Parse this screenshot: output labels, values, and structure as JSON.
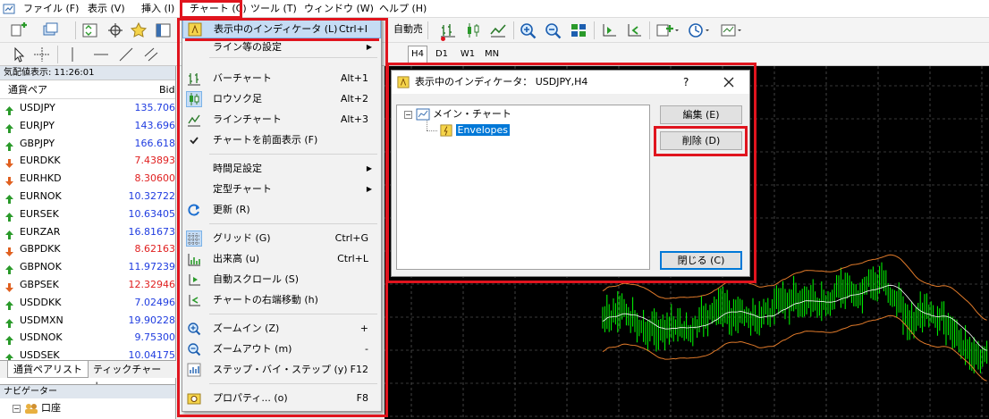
{
  "menubar": {
    "items": [
      "ファイル (F)",
      "表示 (V)",
      "挿入 (I)",
      "チャート (C)",
      "ツール (T)",
      "ウィンドウ (W)",
      "ヘルプ (H)"
    ]
  },
  "toolbar": {
    "auto_trade_label": "自動売買",
    "timeframes": [
      "H4",
      "D1",
      "W1",
      "MN"
    ],
    "active_timeframe": "H4"
  },
  "market_watch": {
    "title": "気配値表示: 11:26:01",
    "columns": {
      "symbol": "通貨ペア",
      "bid": "Bid"
    },
    "rows": [
      {
        "symbol": "USDJPY",
        "bid": "135.706",
        "dir": "up"
      },
      {
        "symbol": "EURJPY",
        "bid": "143.696",
        "dir": "up"
      },
      {
        "symbol": "GBPJPY",
        "bid": "166.618",
        "dir": "up"
      },
      {
        "symbol": "EURDKK",
        "bid": "7.43893",
        "dir": "down"
      },
      {
        "symbol": "EURHKD",
        "bid": "8.30600",
        "dir": "down"
      },
      {
        "symbol": "EURNOK",
        "bid": "10.32722",
        "dir": "up"
      },
      {
        "symbol": "EURSEK",
        "bid": "10.63405",
        "dir": "up"
      },
      {
        "symbol": "EURZAR",
        "bid": "16.81673",
        "dir": "up"
      },
      {
        "symbol": "GBPDKK",
        "bid": "8.62163",
        "dir": "down"
      },
      {
        "symbol": "GBPNOK",
        "bid": "11.97239",
        "dir": "up"
      },
      {
        "symbol": "GBPSEK",
        "bid": "12.32946",
        "dir": "down"
      },
      {
        "symbol": "USDDKK",
        "bid": "7.02496",
        "dir": "up"
      },
      {
        "symbol": "USDMXN",
        "bid": "19.90228",
        "dir": "up"
      },
      {
        "symbol": "USDNOK",
        "bid": "9.75300",
        "dir": "up"
      },
      {
        "symbol": "USDSEK",
        "bid": "10.04175",
        "dir": "up"
      }
    ],
    "tabs": [
      "通貨ペアリスト",
      "ティックチャート"
    ]
  },
  "navigator": {
    "title": "ナビゲーター",
    "root_label": "口座"
  },
  "chart_menu": {
    "items": [
      {
        "label": "表示中のインディケータ (L)",
        "shortcut": "Ctrl+I",
        "icon": "indicator-list-icon"
      },
      {
        "label": "ライン等の設定",
        "shortcut": "",
        "icon": "",
        "submenu": true
      },
      {
        "label": "バーチャート",
        "shortcut": "Alt+1",
        "icon": "bar-chart-icon"
      },
      {
        "label": "ロウソク足",
        "shortcut": "Alt+2",
        "icon": "candlestick-icon"
      },
      {
        "label": "ラインチャート",
        "shortcut": "Alt+3",
        "icon": "line-chart-icon"
      },
      {
        "label": "チャートを前面表示 (F)",
        "shortcut": "",
        "icon": "checkmark-icon"
      },
      {
        "label": "時間足設定",
        "shortcut": "",
        "icon": "",
        "submenu": true
      },
      {
        "label": "定型チャート",
        "shortcut": "",
        "icon": "",
        "submenu": true
      },
      {
        "label": "更新 (R)",
        "shortcut": "",
        "icon": "refresh-icon"
      },
      {
        "label": "グリッド (G)",
        "shortcut": "Ctrl+G",
        "icon": "grid-icon"
      },
      {
        "label": "出来高 (u)",
        "shortcut": "Ctrl+L",
        "icon": "volume-icon"
      },
      {
        "label": "自動スクロール (S)",
        "shortcut": "",
        "icon": "auto-scroll-icon"
      },
      {
        "label": "チャートの右端移動 (h)",
        "shortcut": "",
        "icon": "chart-shift-icon"
      },
      {
        "label": "ズームイン (Z)",
        "shortcut": "+",
        "icon": "zoom-in-icon"
      },
      {
        "label": "ズームアウト (m)",
        "shortcut": "-",
        "icon": "zoom-out-icon"
      },
      {
        "label": "ステップ・バイ・ステップ (y)",
        "shortcut": "F12",
        "icon": "step-icon"
      },
      {
        "label": "プロパティ... (o)",
        "shortcut": "F8",
        "icon": "properties-icon"
      }
    ]
  },
  "dialog": {
    "title": "表示中のインディケータ： USDJPY,H4",
    "help_label": "?",
    "tree_root": "メイン・チャート",
    "tree_child": "Envelopes",
    "edit_button": "編集 (E)",
    "delete_button": "削除 (D)",
    "close_button": "閉じる (C)"
  },
  "colors": {
    "annotation_red": "#e0141e",
    "candle_green": "#00ff00",
    "envelope_orange": "#e07a2a",
    "ma_white": "#ffffff",
    "grid_gray": "#6e6e6e",
    "bid_up_blue": "#1f3ce0",
    "bid_down_red": "#e02020",
    "selection_blue": "#0078d7"
  }
}
